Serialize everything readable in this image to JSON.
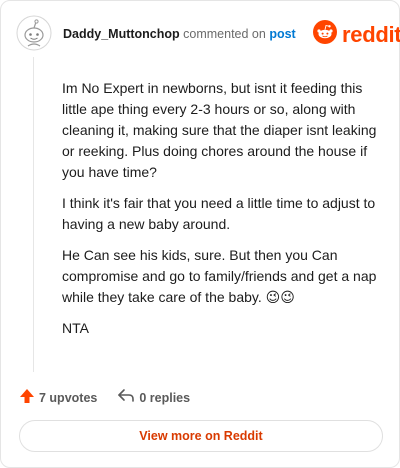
{
  "comment": {
    "username": "Daddy_Muttonchop",
    "action_text": "commented on",
    "target_link": "post",
    "paragraphs": [
      "Im No Expert in newborns, but isnt it feeding this little ape thing every 2-3 hours or so, along with cleaning it, making sure that the diaper isnt leaking or reeking. Plus doing chores around the house if you have time?",
      "I think it's fair that you need a little time to adjust to having a new baby around.",
      "He Can see his kids, sure. But then you Can compromise and go to family/friends and get a nap while they take care of the baby. 😉😉",
      "NTA"
    ]
  },
  "brand": {
    "logo_text": "reddit",
    "color": "#ff4500"
  },
  "actions": {
    "upvotes_label": "7 upvotes",
    "replies_label": "0 replies"
  },
  "footer": {
    "view_more_label": "View more on Reddit"
  },
  "icons": {
    "avatar": "snoo-avatar-icon",
    "logo": "reddit-logo-icon",
    "upvote": "upvote-arrow-icon",
    "reply": "reply-arrow-icon"
  },
  "colors": {
    "accent": "#ff4500",
    "link": "#0079d3",
    "cta": "#d93a00"
  }
}
